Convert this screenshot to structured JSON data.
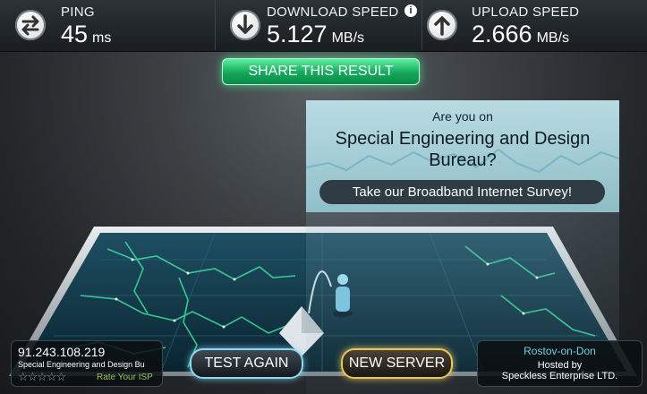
{
  "stats": {
    "ping": {
      "label": "PING",
      "value": "45",
      "unit": "ms",
      "icon": "exchange-arrows-icon"
    },
    "download": {
      "label": "DOWNLOAD SPEED",
      "value": "5.127",
      "unit": "MB/s",
      "icon": "download-arrow-icon",
      "info_icon": "i"
    },
    "upload": {
      "label": "UPLOAD SPEED",
      "value": "2.666",
      "unit": "MB/s",
      "icon": "upload-arrow-icon"
    }
  },
  "share_button": "SHARE THIS RESULT",
  "survey": {
    "question_line1": "Are you on",
    "question_line2": "Special Engineering and Design Bureau?",
    "button": "Take our Broadband Internet Survey!"
  },
  "client": {
    "ip": "91.243.108.219",
    "isp": "Special Engineering and Design Bu",
    "stars": "☆☆☆☆☆",
    "rate_link": "Rate Your ISP"
  },
  "server": {
    "city": "Rostov-on-Don",
    "hosted_by": "Hosted by",
    "host": "Speckless Enterprise LTD."
  },
  "actions": {
    "test_again": "TEST AGAIN",
    "new_server": "NEW SERVER"
  },
  "colors": {
    "accent_green": "#2ed17a",
    "map_line": "#3bd69a",
    "new_server_border": "#e8c75a",
    "test_again_border": "#8fd6ee"
  }
}
